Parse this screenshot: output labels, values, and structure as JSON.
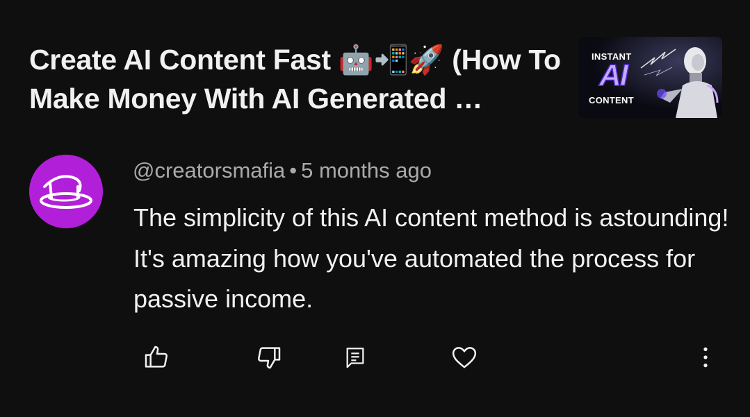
{
  "video": {
    "title": "Create AI Content Fast 🤖📲🚀 (How To Make Money With AI Generated …",
    "thumbnail": {
      "top_text": "INSTANT",
      "big_text": "AI",
      "bottom_text": "CONTENT"
    }
  },
  "comment": {
    "author": "@creatorsmafia",
    "separator": "•",
    "time": "5 months ago",
    "text": "The simplicity of this AI content method is astounding! It's amazing how you've automated the process for passive income.",
    "avatar_color": "#b21fd9"
  },
  "actions": {
    "like_icon": "thumb-up-icon",
    "dislike_icon": "thumb-down-icon",
    "reply_icon": "reply-comment-icon",
    "heart_icon": "heart-icon",
    "more_icon": "more-vertical-icon"
  },
  "colors": {
    "background": "#0f0f0f",
    "primary_text": "#f1f1f1",
    "secondary_text": "#aaaaaa"
  }
}
